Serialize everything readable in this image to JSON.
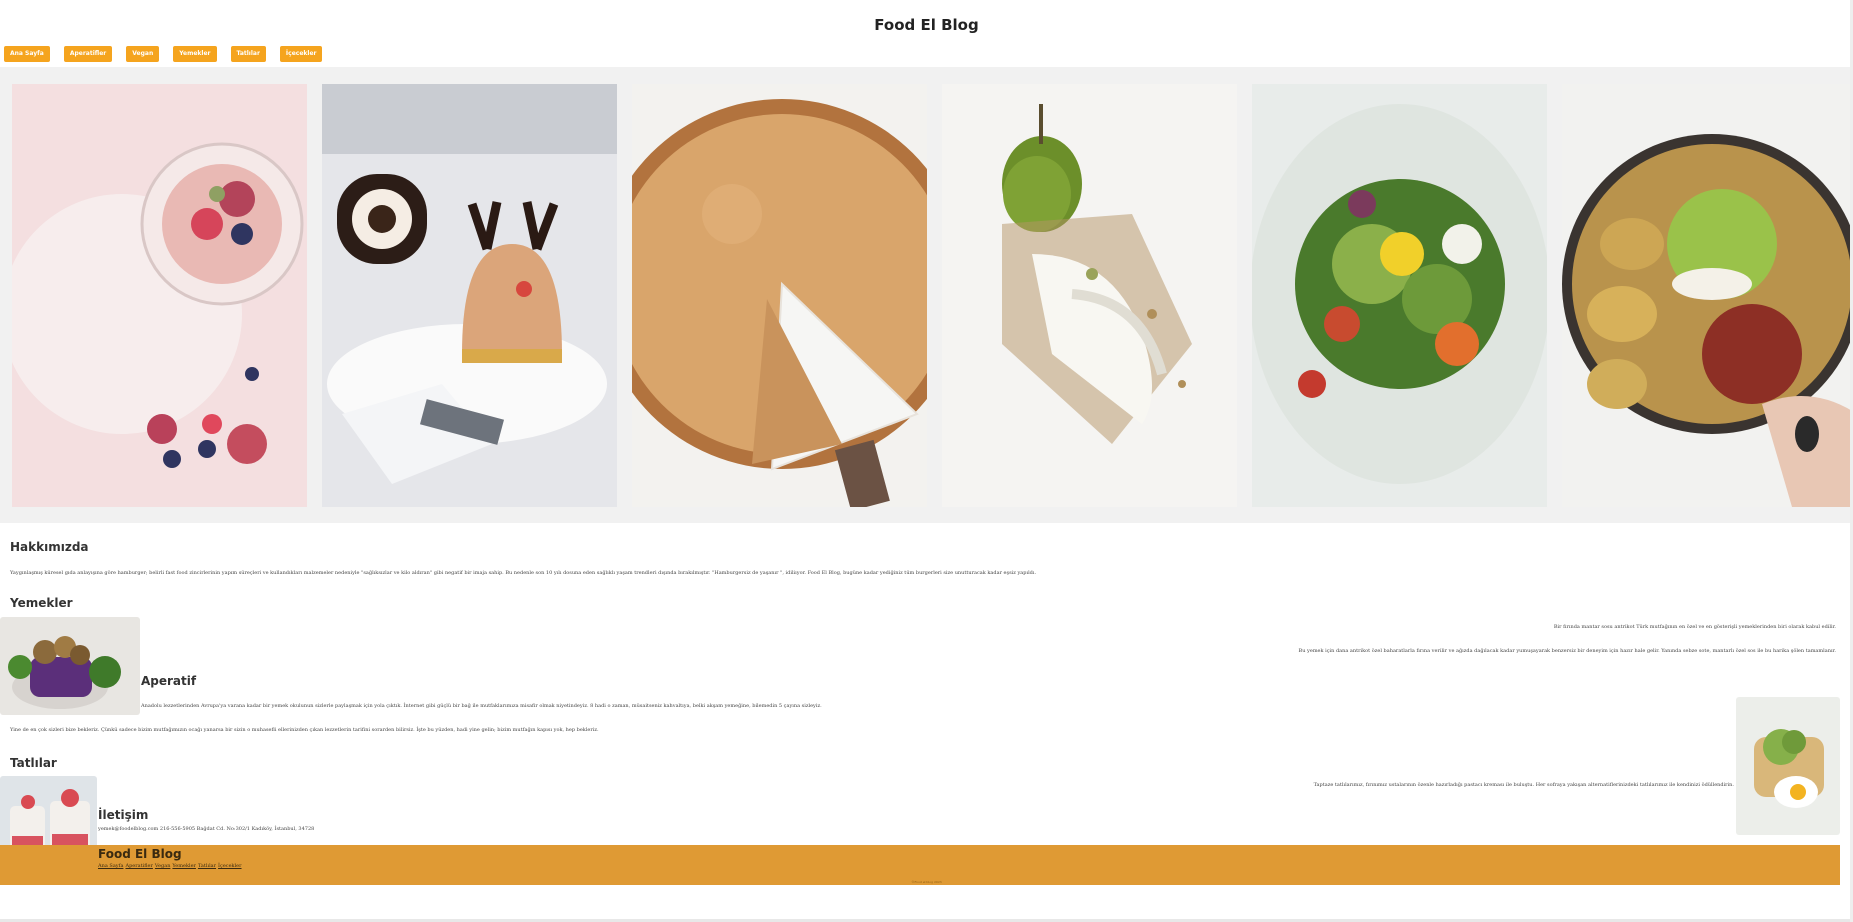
{
  "site": {
    "title": "Food El Blog"
  },
  "nav": [
    "Ana Sayfa",
    "Aperatifler",
    "Vegan",
    "Yemekler",
    "Tatlılar",
    "İçecekler"
  ],
  "gallery": {
    "images": [
      {
        "icon": "chia-pudding-jar-photo"
      },
      {
        "icon": "reindeer-dessert-photo"
      },
      {
        "icon": "pie-slice-photo"
      },
      {
        "icon": "pear-dish-photo"
      },
      {
        "icon": "salad-bowl-photo"
      },
      {
        "icon": "potato-bowl-photo"
      }
    ]
  },
  "about": {
    "heading": "Hakkımızda",
    "text": "Yaygınlaşmış küresel gıda anlayışına göre hamburger; belirli fast food zincirlerinin yapım süreçleri ve kullandıkları malzemeler nedeniyle \"sağlıksızlar ve kilo aldıran\" gibi negatif bir imaja sahip. Bu nedenle son 10 yılı dosuna eden sağlıklı yaşam trendleri dışında bırakılmıştır. \"Hamburgersiz de yaşanır \", idiliıyor. Food El Blog, bugüne kadar yediğiniz tüm burgerleri size unutturacak kadar eşsiz yapıldı."
  },
  "meals": {
    "heading": "Yemekler",
    "text1": "Bir fırında mantar sosu antrikot Türk mutfağının en özel ve en gösterişli yemeklerinden biri olarak kabul edilir.",
    "text2": "Bu yemek için dana antrikot özel baharatlarla fırına verilir ve ağızda dağılacak kadar yumuşayarak benzersiz bir deneyim için hazır hale gelir. Yanında sebze sote, mantarlı özel sos ile bu harika şölen tamamlanır."
  },
  "appetizer": {
    "heading": "Aperatif",
    "text1": "Anadolu lezzetlerinden Avrupa'ya varana kadar bir yemek okulunun sizlerle paylaşmak için yola çıktık. İnternet gibi güçlü bir bağ ile mutfaklarımıza misafir olmak niyetindeyiz. 8 hadi o zaman, müsaitseniz kahvaltıya, belki akşam yemeğine, bilemedin 5 çayına sizleyiz.",
    "text2": "Yine de en çok sizleri bize bekleriz. Çünkü sadece bizim mutfağımızın ocağı yanarsa bir sizin o muhasefli ellerinizden çıkan lezzetlerin tarifini sorarden bilirsiz. İşte bu yüzden, hadi yine gelin; bizim mutfağın kapısı yok, hep bekleriz."
  },
  "desserts": {
    "heading": "Tatlılar",
    "text": "Taptaze tatlılarımız, fırınımız ustalarının özenle hazırladığı pastacı kreması ile buluştu. Her sofraya yakışan alternatiflerinizdeki tatlılarımız ile kendinizi ödüllendirin."
  },
  "contact": {
    "heading": "İletişim",
    "text": "yemek@foodelblog.com 216-556-5905 Bağdat Cd. No:302/1 Kadıköy, İstanbul, 34728"
  },
  "footer": {
    "title": "Food El Blog",
    "links": [
      "Ana Sayfa",
      "Aperatifler",
      "Vegan",
      "Yemekler",
      "Tatlılar",
      "İçecekler"
    ],
    "copyright": "©Food el blog 2023"
  },
  "colors": {
    "accent": "#f5a41e",
    "footer": "#df9a34",
    "gallery_bg": "#f1f1f1"
  }
}
